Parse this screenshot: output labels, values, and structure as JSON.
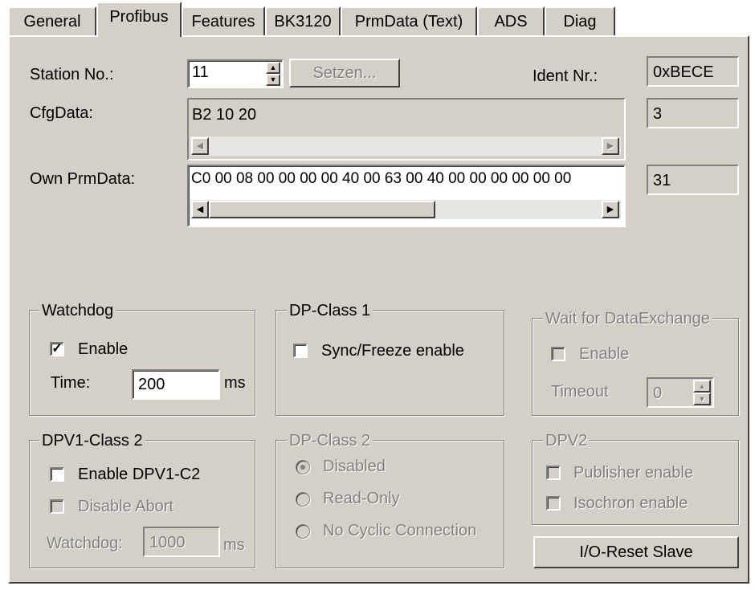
{
  "tabs": [
    "General",
    "Profibus",
    "Features",
    "BK3120",
    "PrmData (Text)",
    "ADS",
    "Diag"
  ],
  "active_tab": "Profibus",
  "station": {
    "label": "Station No.:",
    "value": "11",
    "set_button": "Setzen..."
  },
  "ident": {
    "label": "Ident Nr.:",
    "value": "0xBECE"
  },
  "cfg": {
    "label": "CfgData:",
    "value": "B2 10 20",
    "count": "3"
  },
  "prm": {
    "label": "Own PrmData:",
    "value": "C0 00 08 00 00 00 00 40 00 63 00 40 00 00 00 00 00 00",
    "count": "31"
  },
  "watchdog": {
    "title": "Watchdog",
    "enable_label": "Enable",
    "enabled": true,
    "time_label": "Time:",
    "time_value": "200",
    "unit": "ms"
  },
  "dp_class1": {
    "title": "DP-Class 1",
    "sync_label": "Sync/Freeze enable"
  },
  "wait": {
    "title": "Wait for DataExchange",
    "enable_label": "Enable",
    "timeout_label": "Timeout",
    "timeout_value": "0"
  },
  "dpv1": {
    "title": "DPV1-Class 2",
    "enable_label": "Enable DPV1-C2",
    "abort_label": "Disable Abort",
    "watchdog_label": "Watchdog:",
    "watchdog_value": "1000",
    "unit": "ms"
  },
  "dp_class2": {
    "title": "DP-Class 2",
    "options": [
      "Disabled",
      "Read-Only",
      "No Cyclic Connection"
    ],
    "selected": "Disabled"
  },
  "dpv2": {
    "title": "DPV2",
    "publisher_label": "Publisher enable",
    "isochron_label": "Isochron enable"
  },
  "reset_button": "I/O-Reset Slave",
  "colors": {
    "face": "#d4d0c8",
    "shadow": "#808080",
    "highlight": "#ffffff"
  }
}
